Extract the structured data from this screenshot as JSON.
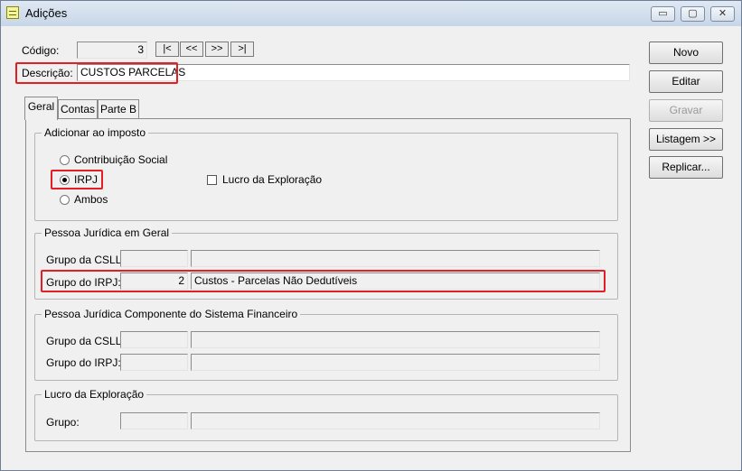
{
  "window": {
    "title": "Adições",
    "icon": "form-icon",
    "controls": {
      "minimize": "▭",
      "restore": "▢",
      "close": "✕"
    }
  },
  "header": {
    "codigo_label": "Código:",
    "codigo_value": "3",
    "nav_buttons": [
      "|<",
      "<<",
      ">>",
      ">|"
    ],
    "descricao_label": "Descrição:",
    "descricao_value": "CUSTOS PARCELAS"
  },
  "side_buttons": [
    {
      "label": "Novo",
      "enabled": true
    },
    {
      "label": "Editar",
      "enabled": true
    },
    {
      "label": "Gravar",
      "enabled": false
    },
    {
      "label": "Listagem >>",
      "enabled": true
    },
    {
      "label": "Replicar...",
      "enabled": true
    }
  ],
  "tabs": [
    {
      "label": "Geral",
      "active": true
    },
    {
      "label": "Contas",
      "active": false
    },
    {
      "label": "Parte B",
      "active": false
    }
  ],
  "adicionar": {
    "legend": "Adicionar ao imposto",
    "options": [
      {
        "label": "Contribuição Social",
        "selected": false
      },
      {
        "label": "IRPJ",
        "selected": true
      },
      {
        "label": "Ambos",
        "selected": false
      }
    ],
    "lucro_checkbox": {
      "label": "Lucro da Exploração",
      "checked": false
    }
  },
  "pj_geral": {
    "legend": "Pessoa Jurídica em Geral",
    "csll_label": "Grupo da CSLL:",
    "csll_code": "",
    "csll_desc": "",
    "irpj_label": "Grupo do IRPJ:",
    "irpj_code": "2",
    "irpj_desc": "Custos - Parcelas Não Dedutíveis"
  },
  "pj_financeiro": {
    "legend": "Pessoa Jurídica Componente do Sistema Financeiro",
    "csll_label": "Grupo da CSLL:",
    "csll_code": "",
    "csll_desc": "",
    "irpj_label": "Grupo do IRPJ:",
    "irpj_code": "",
    "irpj_desc": ""
  },
  "lucro_exploracao": {
    "legend": "Lucro da Exploração",
    "grupo_label": "Grupo:",
    "grupo_code": "",
    "grupo_desc": ""
  },
  "colors": {
    "highlight": "#e41e25",
    "window_bg": "#f0f0f0"
  }
}
